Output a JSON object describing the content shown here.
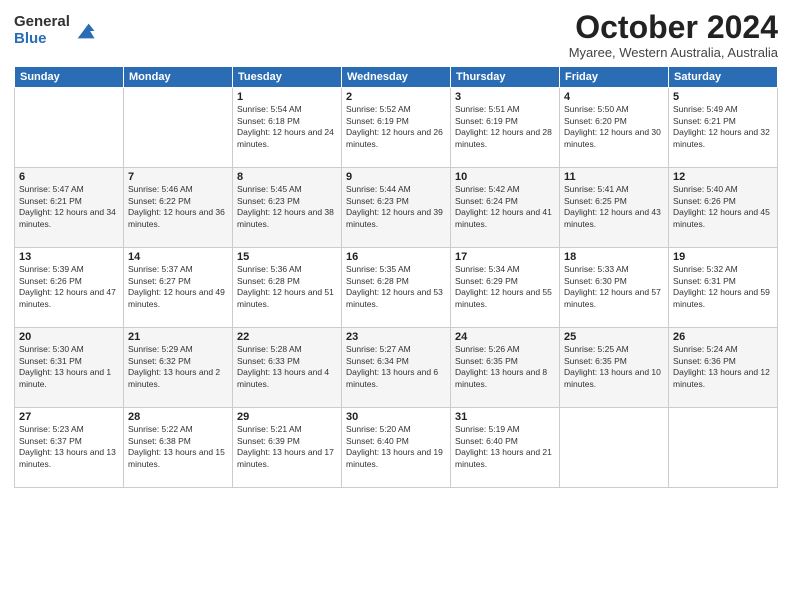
{
  "logo": {
    "general": "General",
    "blue": "Blue"
  },
  "header": {
    "month": "October 2024",
    "location": "Myaree, Western Australia, Australia"
  },
  "days_of_week": [
    "Sunday",
    "Monday",
    "Tuesday",
    "Wednesday",
    "Thursday",
    "Friday",
    "Saturday"
  ],
  "weeks": [
    [
      {
        "day": "",
        "info": ""
      },
      {
        "day": "",
        "info": ""
      },
      {
        "day": "1",
        "info": "Sunrise: 5:54 AM\nSunset: 6:18 PM\nDaylight: 12 hours and 24 minutes."
      },
      {
        "day": "2",
        "info": "Sunrise: 5:52 AM\nSunset: 6:19 PM\nDaylight: 12 hours and 26 minutes."
      },
      {
        "day": "3",
        "info": "Sunrise: 5:51 AM\nSunset: 6:19 PM\nDaylight: 12 hours and 28 minutes."
      },
      {
        "day": "4",
        "info": "Sunrise: 5:50 AM\nSunset: 6:20 PM\nDaylight: 12 hours and 30 minutes."
      },
      {
        "day": "5",
        "info": "Sunrise: 5:49 AM\nSunset: 6:21 PM\nDaylight: 12 hours and 32 minutes."
      }
    ],
    [
      {
        "day": "6",
        "info": "Sunrise: 5:47 AM\nSunset: 6:21 PM\nDaylight: 12 hours and 34 minutes."
      },
      {
        "day": "7",
        "info": "Sunrise: 5:46 AM\nSunset: 6:22 PM\nDaylight: 12 hours and 36 minutes."
      },
      {
        "day": "8",
        "info": "Sunrise: 5:45 AM\nSunset: 6:23 PM\nDaylight: 12 hours and 38 minutes."
      },
      {
        "day": "9",
        "info": "Sunrise: 5:44 AM\nSunset: 6:23 PM\nDaylight: 12 hours and 39 minutes."
      },
      {
        "day": "10",
        "info": "Sunrise: 5:42 AM\nSunset: 6:24 PM\nDaylight: 12 hours and 41 minutes."
      },
      {
        "day": "11",
        "info": "Sunrise: 5:41 AM\nSunset: 6:25 PM\nDaylight: 12 hours and 43 minutes."
      },
      {
        "day": "12",
        "info": "Sunrise: 5:40 AM\nSunset: 6:26 PM\nDaylight: 12 hours and 45 minutes."
      }
    ],
    [
      {
        "day": "13",
        "info": "Sunrise: 5:39 AM\nSunset: 6:26 PM\nDaylight: 12 hours and 47 minutes."
      },
      {
        "day": "14",
        "info": "Sunrise: 5:37 AM\nSunset: 6:27 PM\nDaylight: 12 hours and 49 minutes."
      },
      {
        "day": "15",
        "info": "Sunrise: 5:36 AM\nSunset: 6:28 PM\nDaylight: 12 hours and 51 minutes."
      },
      {
        "day": "16",
        "info": "Sunrise: 5:35 AM\nSunset: 6:28 PM\nDaylight: 12 hours and 53 minutes."
      },
      {
        "day": "17",
        "info": "Sunrise: 5:34 AM\nSunset: 6:29 PM\nDaylight: 12 hours and 55 minutes."
      },
      {
        "day": "18",
        "info": "Sunrise: 5:33 AM\nSunset: 6:30 PM\nDaylight: 12 hours and 57 minutes."
      },
      {
        "day": "19",
        "info": "Sunrise: 5:32 AM\nSunset: 6:31 PM\nDaylight: 12 hours and 59 minutes."
      }
    ],
    [
      {
        "day": "20",
        "info": "Sunrise: 5:30 AM\nSunset: 6:31 PM\nDaylight: 13 hours and 1 minute."
      },
      {
        "day": "21",
        "info": "Sunrise: 5:29 AM\nSunset: 6:32 PM\nDaylight: 13 hours and 2 minutes."
      },
      {
        "day": "22",
        "info": "Sunrise: 5:28 AM\nSunset: 6:33 PM\nDaylight: 13 hours and 4 minutes."
      },
      {
        "day": "23",
        "info": "Sunrise: 5:27 AM\nSunset: 6:34 PM\nDaylight: 13 hours and 6 minutes."
      },
      {
        "day": "24",
        "info": "Sunrise: 5:26 AM\nSunset: 6:35 PM\nDaylight: 13 hours and 8 minutes."
      },
      {
        "day": "25",
        "info": "Sunrise: 5:25 AM\nSunset: 6:35 PM\nDaylight: 13 hours and 10 minutes."
      },
      {
        "day": "26",
        "info": "Sunrise: 5:24 AM\nSunset: 6:36 PM\nDaylight: 13 hours and 12 minutes."
      }
    ],
    [
      {
        "day": "27",
        "info": "Sunrise: 5:23 AM\nSunset: 6:37 PM\nDaylight: 13 hours and 13 minutes."
      },
      {
        "day": "28",
        "info": "Sunrise: 5:22 AM\nSunset: 6:38 PM\nDaylight: 13 hours and 15 minutes."
      },
      {
        "day": "29",
        "info": "Sunrise: 5:21 AM\nSunset: 6:39 PM\nDaylight: 13 hours and 17 minutes."
      },
      {
        "day": "30",
        "info": "Sunrise: 5:20 AM\nSunset: 6:40 PM\nDaylight: 13 hours and 19 minutes."
      },
      {
        "day": "31",
        "info": "Sunrise: 5:19 AM\nSunset: 6:40 PM\nDaylight: 13 hours and 21 minutes."
      },
      {
        "day": "",
        "info": ""
      },
      {
        "day": "",
        "info": ""
      }
    ]
  ]
}
